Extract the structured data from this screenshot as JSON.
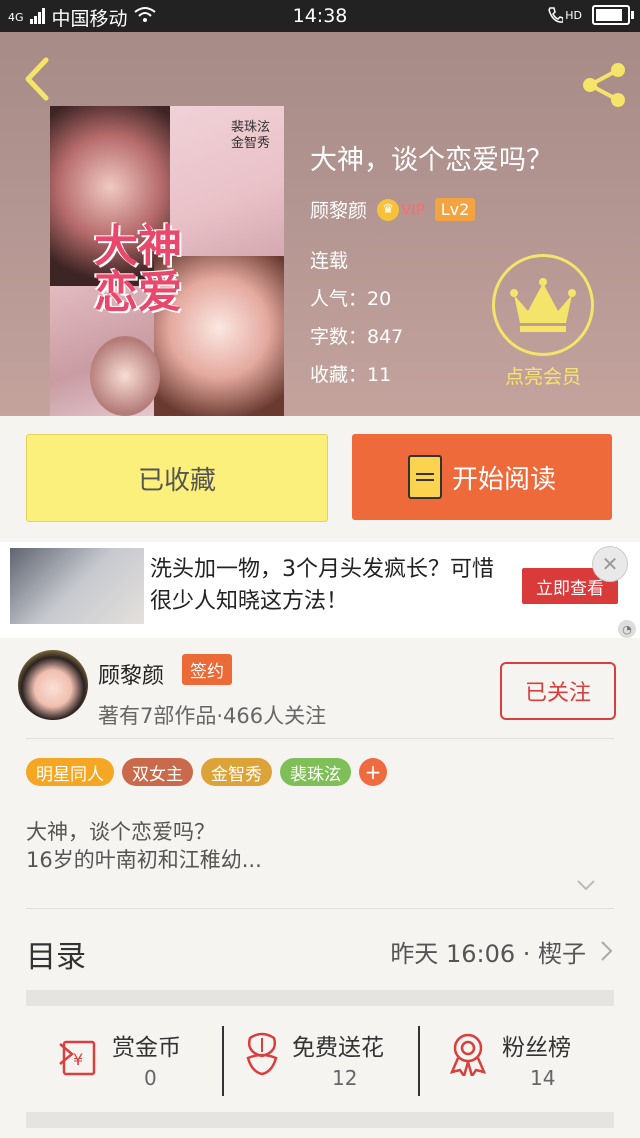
{
  "status_bar": {
    "network": "4G",
    "carrier": "中国移动",
    "time": "14:38",
    "hd": "HD"
  },
  "book": {
    "title": "大神，谈个恋爱吗？",
    "author": "顾黎颜",
    "vip_label": "VIP",
    "level": "Lv2",
    "status": "连载",
    "popularity": "人气：20",
    "word_count": "字数：847",
    "favorites": "收藏：11",
    "cover_title": "大神恋爱",
    "cover_names": [
      "裴珠泫",
      "金智秀"
    ]
  },
  "member_label": "点亮会员",
  "actions": {
    "favorited_label": "已收藏",
    "read_label": "开始阅读"
  },
  "ad": {
    "text": "洗头加一物，3个月头发疯长？可惜很少人知晓这方法！",
    "cta": "立即查看"
  },
  "author_card": {
    "name": "顾黎颜",
    "badge": "签约",
    "works": "著有7部作品·466人关注",
    "follow_label": "已关注"
  },
  "tags": [
    {
      "label": "明星同人",
      "color": "#f5a623"
    },
    {
      "label": "双女主",
      "color": "#c96a4c"
    },
    {
      "label": "金智秀",
      "color": "#dba338"
    },
    {
      "label": "裴珠泫",
      "color": "#7fbf58"
    }
  ],
  "tag_more": "+",
  "description": {
    "line1": "大神，谈个恋爱吗？",
    "line2": "16岁的叶南初和江稚幼..."
  },
  "toc": {
    "label": "目录",
    "update": "昨天 16:06 · 楔子"
  },
  "stats": [
    {
      "label": "赏金币",
      "value": "0",
      "icon": "reward-coin-icon"
    },
    {
      "label": "免费送花",
      "value": "12",
      "icon": "flower-icon"
    },
    {
      "label": "粉丝榜",
      "value": "14",
      "icon": "medal-icon"
    }
  ]
}
